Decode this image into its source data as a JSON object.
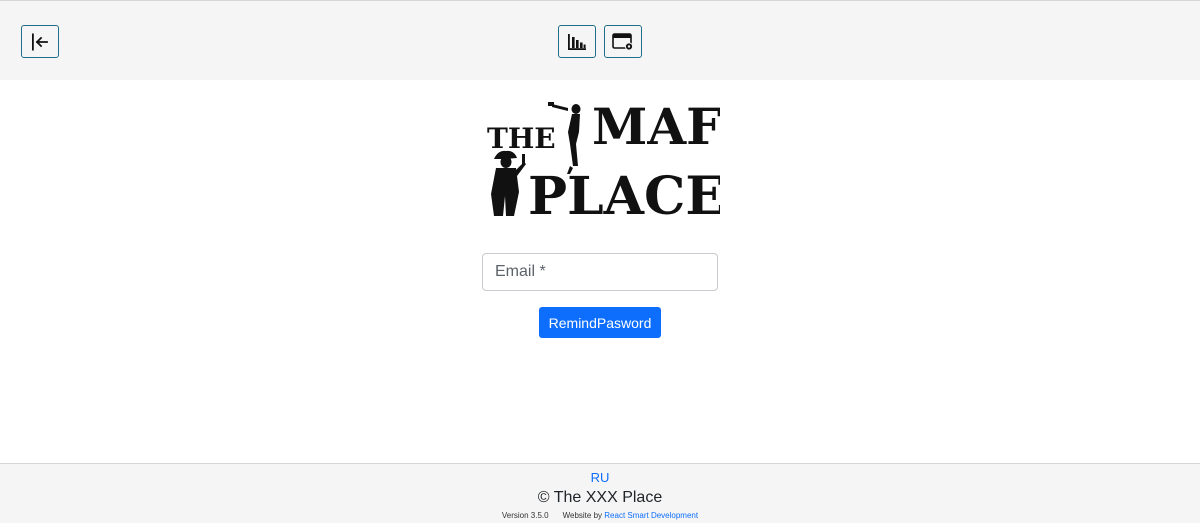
{
  "header": {
    "buttons": [
      {
        "icon": "logout-icon"
      },
      {
        "icon": "bar-chart-icon"
      },
      {
        "icon": "browser-window-settings-icon"
      }
    ],
    "accent_color": "#1f6f8b"
  },
  "logo": {
    "line1_prefix": "THE",
    "line1_main": "MAF",
    "line2": "PLACE"
  },
  "form": {
    "email_placeholder": "Email *",
    "email_value": "",
    "submit_label": "RemindPasword",
    "button_color": "#0d6efd"
  },
  "footer": {
    "language": "RU",
    "copyright": "© The XXX Place",
    "version": "Version 3.5.0",
    "website_by": "Website by",
    "developer": "React Smart Development"
  }
}
